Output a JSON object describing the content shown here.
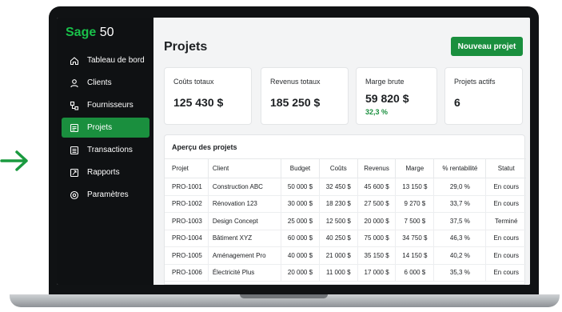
{
  "brand": {
    "sage": "Sage",
    "num": "50"
  },
  "sidebar": {
    "items": [
      {
        "label": "Tableau de bord",
        "icon": "home-icon",
        "active": false
      },
      {
        "label": "Clients",
        "icon": "user-icon",
        "active": false
      },
      {
        "label": "Fournisseurs",
        "icon": "suppliers-icon",
        "active": false
      },
      {
        "label": "Projets",
        "icon": "projects-icon",
        "active": true
      },
      {
        "label": "Transactions",
        "icon": "transactions-icon",
        "active": false
      },
      {
        "label": "Rapports",
        "icon": "reports-icon",
        "active": false
      },
      {
        "label": "Paramètres",
        "icon": "settings-icon",
        "active": false
      }
    ]
  },
  "header": {
    "title": "Projets",
    "new_button": "Nouveau projet"
  },
  "cards": [
    {
      "label": "Coûts totaux",
      "value": "125 430 $"
    },
    {
      "label": "Revenus totaux",
      "value": "185 250 $"
    },
    {
      "label": "Marge brute",
      "value": "59 820 $",
      "sub": "32,3 %"
    },
    {
      "label": "Projets actifs",
      "value": "6"
    }
  ],
  "table": {
    "title": "Aperçu des projets",
    "columns": [
      "Projet",
      "Client",
      "Budget",
      "Coûts",
      "Revenus",
      "Marge",
      "% rentabilité",
      "Statut"
    ],
    "rows": [
      [
        "PRO-1001",
        "Construction ABC",
        "50 000 $",
        "32 450 $",
        "45 600 $",
        "13 150 $",
        "29,0 %",
        "En cours"
      ],
      [
        "PRO-1002",
        "Rénovation 123",
        "30 000 $",
        "18 230 $",
        "27 500 $",
        "9 270 $",
        "33,7 %",
        "En cours"
      ],
      [
        "PRO-1003",
        "Design Concept",
        "25 000 $",
        "12 500 $",
        "20 000 $",
        "7 500 $",
        "37,5 %",
        "Terminé"
      ],
      [
        "PRO-1004",
        "Bâtiment XYZ",
        "60 000 $",
        "40 250 $",
        "75 000 $",
        "34 750 $",
        "46,3 %",
        "En cours"
      ],
      [
        "PRO-1005",
        "Aménagement Pro",
        "40 000 $",
        "21 000 $",
        "35 150 $",
        "14 150 $",
        "40,2 %",
        "En cours"
      ],
      [
        "PRO-1006",
        "Électricité Plus",
        "20 000 $",
        "11 000 $",
        "17 000 $",
        "6 000 $",
        "35,3 %",
        "En cours"
      ]
    ]
  },
  "colors": {
    "accent": "#1a8f3e",
    "brand_green": "#19c04a",
    "sidebar_bg": "#0f1113"
  }
}
